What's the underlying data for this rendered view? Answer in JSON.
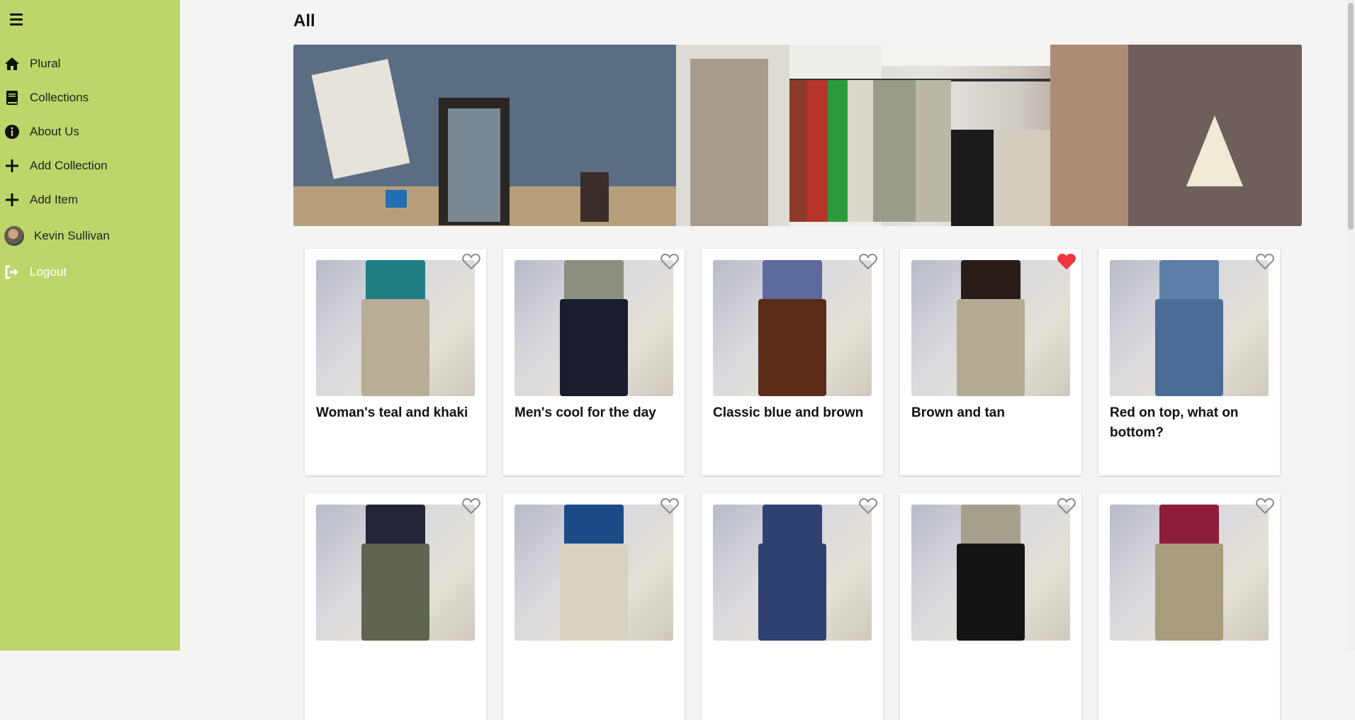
{
  "sidebar": {
    "items": [
      {
        "label": "Plural",
        "icon": "home-icon"
      },
      {
        "label": "Collections",
        "icon": "book-icon"
      },
      {
        "label": "About Us",
        "icon": "info-icon"
      },
      {
        "label": "Add Collection",
        "icon": "plus-icon"
      },
      {
        "label": "Add Item",
        "icon": "plus-icon"
      },
      {
        "label": "Kevin Sullivan",
        "icon": "avatar"
      },
      {
        "label": "Logout",
        "icon": "logout-icon"
      }
    ]
  },
  "page": {
    "title": "All"
  },
  "cards": [
    {
      "title": "Woman's teal and khaki",
      "favorited": false,
      "top": "#1e7e84",
      "bottom": "#b8ad95"
    },
    {
      "title": "Men's cool for the day",
      "favorited": false,
      "top": "#8d8e80",
      "bottom": "#1a1d2e"
    },
    {
      "title": "Classic blue and brown",
      "favorited": false,
      "top": "#5d6a9e",
      "bottom": "#5a2c18"
    },
    {
      "title": "Brown and tan",
      "favorited": true,
      "top": "#2a1c19",
      "bottom": "#b3ab93"
    },
    {
      "title": "Red on top, what on bottom?",
      "favorited": false,
      "top": "#5c7fa8",
      "bottom": "#4a6c97"
    },
    {
      "title": "",
      "favorited": false,
      "top": "#232437",
      "bottom": "#5f6453"
    },
    {
      "title": "",
      "favorited": false,
      "top": "#1b4a86",
      "bottom": "#d8d2c2"
    },
    {
      "title": "",
      "favorited": false,
      "top": "#2e4170",
      "bottom": "#2e4170"
    },
    {
      "title": "",
      "favorited": false,
      "top": "#a59f8c",
      "bottom": "#141414"
    },
    {
      "title": "",
      "favorited": false,
      "top": "#8e1d3c",
      "bottom": "#a89d7c"
    }
  ],
  "colors": {
    "sidebar": "#bcd66a",
    "heart_active": "#f0353c",
    "heart_inactive": "#8a8a8a"
  }
}
